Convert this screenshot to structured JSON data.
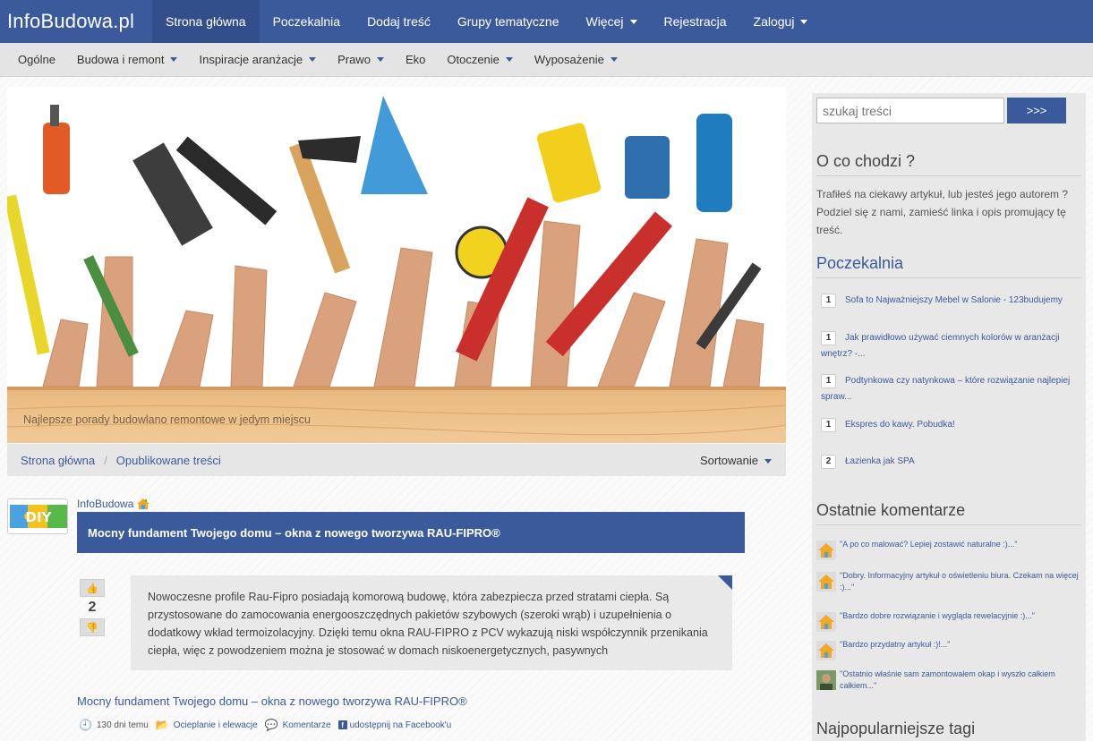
{
  "brand": "InfoBudowa.pl",
  "topnav": [
    {
      "label": "Strona główna",
      "active": true,
      "dropdown": false
    },
    {
      "label": "Poczekalnia",
      "active": false,
      "dropdown": false
    },
    {
      "label": "Dodaj treść",
      "active": false,
      "dropdown": false
    },
    {
      "label": "Grupy tematyczne",
      "active": false,
      "dropdown": false
    },
    {
      "label": "Więcej",
      "active": false,
      "dropdown": true
    },
    {
      "label": "Rejestracja",
      "active": false,
      "dropdown": false
    },
    {
      "label": "Zaloguj",
      "active": false,
      "dropdown": true
    }
  ],
  "subnav": [
    {
      "label": "Ogólne",
      "dropdown": false
    },
    {
      "label": "Budowa i remont",
      "dropdown": true
    },
    {
      "label": "Inspiracje aranżacje",
      "dropdown": true
    },
    {
      "label": "Prawo",
      "dropdown": true
    },
    {
      "label": "Eko",
      "dropdown": false
    },
    {
      "label": "Otoczenie",
      "dropdown": true
    },
    {
      "label": "Wyposażenie",
      "dropdown": true
    }
  ],
  "hero": {
    "caption": "Najlepsze porady budowlano remontowe w jedym miejscu"
  },
  "breadcrumb": [
    "Strona główna",
    "Opublikowane treści"
  ],
  "sort_label": "Sortowanie",
  "article": {
    "author": "InfoBudowa",
    "avatar_text": "DIY",
    "title": "Mocny fundament Twojego domu – okna z nowego tworzywa RAU-FIPRO®",
    "votes": "2",
    "excerpt": "Nowoczesne profile Rau-Fipro posiadają komorową budowę, która zabezpiecza przed stratami ciepła. Są przystosowane do zamocowania energooszczędnych pakietów szybowych (szeroki wrąb) i uzupełnienia o dodatkowy wkład termoizolacyjny. Dzięki temu okna RAU-FIPRO z PCV wykazują niski współczynnik przenikania ciepła, więc z powodzeniem można je stosować w domach niskoenergetycznych, pasywnych",
    "link": "Mocny fundament Twojego domu – okna z nowego tworzywa RAU-FIPRO®",
    "meta": {
      "time": "130 dni temu",
      "category": "Ocieplanie i elewacje",
      "comments": "Komentarze",
      "share": "udostępnij na Facebook'u"
    }
  },
  "sidebar": {
    "search_placeholder": "szukaj treści",
    "search_button": ">>>",
    "about_title": "O co chodzi ?",
    "about_text": "Trafiłeś na ciekawy artykuł, lub jesteś jego autorem ? Podziel się z nami, zamieść linka i opis promujący tę treść.",
    "waiting_title": "Poczekalnia",
    "waiting": [
      {
        "count": "1",
        "text": "Sofa to Najważniejszy Mebel w Salonie - 123budujemy"
      },
      {
        "count": "1",
        "text": "Jak prawidłowo używać ciemnych kolorów w aranżacji wnętrz? -..."
      },
      {
        "count": "1",
        "text": "Podtynkowa czy natynkowa – które rozwiązanie najlepiej spraw..."
      },
      {
        "count": "1",
        "text": "Ekspres do kawy. Pobudka!"
      },
      {
        "count": "2",
        "text": "Łazienka jak SPA"
      }
    ],
    "comments_title": "Ostatnie komentarze",
    "comments": [
      {
        "text": "\"A po co malować? Lepiej zostawić naturalne :)...\"",
        "avatar": "house-avatar-icon"
      },
      {
        "text": "\"Dobry. Informacyjny artykuł o oświetleniu biura. Czekam na więcej :)...\"",
        "avatar": "house-avatar-icon"
      },
      {
        "text": "\"Bardzo dobre rozwiązanie i wygląda rewelacyjnie :)...\"",
        "avatar": "house-avatar-icon"
      },
      {
        "text": "\"Bardzo przydatny artykuł :)!...\"",
        "avatar": "house-avatar-icon"
      },
      {
        "text": "\"Ostatnio właśnie sam zamontowałem okap i wyszło całkiem całkiem...\"",
        "avatar": "user-photo-icon"
      }
    ],
    "tags_title": "Najpopularniejsze tagi"
  },
  "colors": {
    "primary": "#3b5a9c",
    "subnav_bg": "#e4e4e4",
    "sidebar_bg": "#e8e8e8"
  }
}
